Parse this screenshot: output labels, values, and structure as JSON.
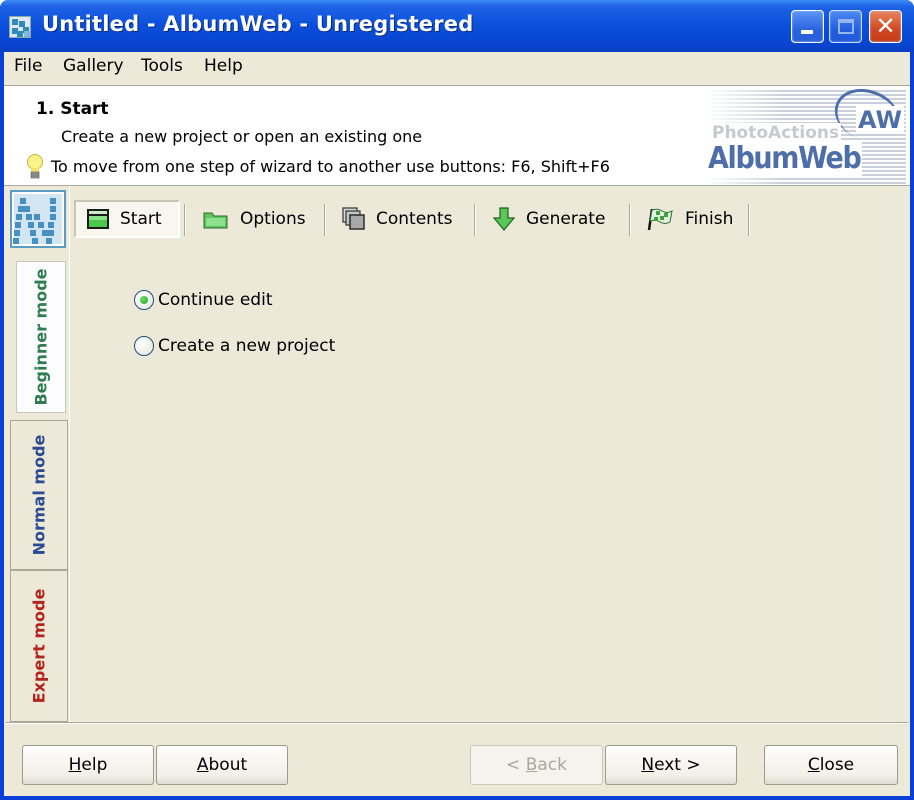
{
  "window": {
    "title": "Untitled - AlbumWeb - Unregistered",
    "controls": {
      "minimize": "minimize",
      "maximize": "maximize",
      "close": "close"
    }
  },
  "menu": [
    {
      "label": "File"
    },
    {
      "label": "Gallery"
    },
    {
      "label": "Tools"
    },
    {
      "label": "Help"
    }
  ],
  "header": {
    "step_title": "1. Start",
    "step_description": "Create a new project or open an existing one",
    "hint": "To move from one step of wizard to another use buttons: F6, Shift+F6",
    "hint_icon": "lightbulb-icon",
    "brand": {
      "small": "PhotoActions",
      "large": "AlbumWeb",
      "badge": "AW"
    }
  },
  "modes": [
    {
      "label": "Beginner mode",
      "color": "#2e7d4f",
      "active": true
    },
    {
      "label": "Normal mode",
      "color": "#2b4a93",
      "active": false
    },
    {
      "label": "Expert mode",
      "color": "#b3241f",
      "active": false
    }
  ],
  "toolbar": [
    {
      "label": "Start",
      "icon": "clapperboard-icon",
      "active": true
    },
    {
      "label": "Options",
      "icon": "folder-icon",
      "active": false
    },
    {
      "label": "Contents",
      "icon": "pages-icon",
      "active": false
    },
    {
      "label": "Generate",
      "icon": "down-arrow-icon",
      "active": false
    },
    {
      "label": "Finish",
      "icon": "checkered-flag-icon",
      "active": false
    }
  ],
  "options": [
    {
      "label": "Continue edit",
      "selected": true
    },
    {
      "label": "Create a new project",
      "selected": false
    }
  ],
  "buttons": {
    "help": {
      "accel": "H",
      "rest": "elp"
    },
    "about": {
      "accel": "A",
      "rest": "bout"
    },
    "back": {
      "pre": "< ",
      "accel": "B",
      "rest": "ack",
      "disabled": true
    },
    "next": {
      "accel": "N",
      "rest": "ext >"
    },
    "close": {
      "accel": "C",
      "rest": "lose"
    }
  }
}
